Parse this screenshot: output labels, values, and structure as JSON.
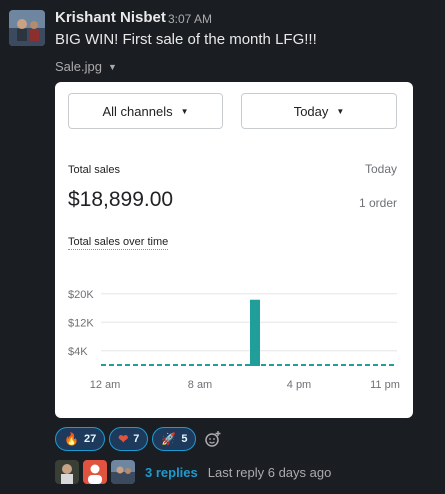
{
  "message": {
    "author": "Krishant Nisbet",
    "time": "3:07 AM",
    "text": "BIG WIN! First sale of the month LFG!!!",
    "file_name": "Sale.jpg"
  },
  "card": {
    "channel_filter": "All channels",
    "date_filter": "Today",
    "total_sales_label": "Total sales",
    "period_label": "Today",
    "total_sales_value": "$18,899.00",
    "orders": "1 order",
    "chart_title": "Total sales over time"
  },
  "chart_data": {
    "type": "bar",
    "title": "Total sales over time",
    "y_tick_labels": [
      "$20K",
      "$12K",
      "$4K"
    ],
    "x_tick_labels": [
      "12 am",
      "8 am",
      "4 pm",
      "11 pm"
    ],
    "ylim": [
      0,
      20000
    ],
    "baseline_series": "dashed line at 0 across the day",
    "bars": [
      {
        "x": "~2 pm",
        "value": 18899
      }
    ],
    "bar_color": "#1f9e9a",
    "grid": true
  },
  "reactions": [
    {
      "emoji": "🔥",
      "icon": "fire-icon",
      "count": "27"
    },
    {
      "emoji": "❤",
      "icon": "heart-icon",
      "count": "7"
    },
    {
      "emoji": "🚀",
      "icon": "rocket-icon",
      "count": "5"
    }
  ],
  "thread": {
    "replies": "3 replies",
    "last_reply": "Last reply 6 days ago"
  },
  "colors": {
    "background": "#1a1d21",
    "link": "#1d9bd1",
    "bar": "#1f9e9a"
  }
}
